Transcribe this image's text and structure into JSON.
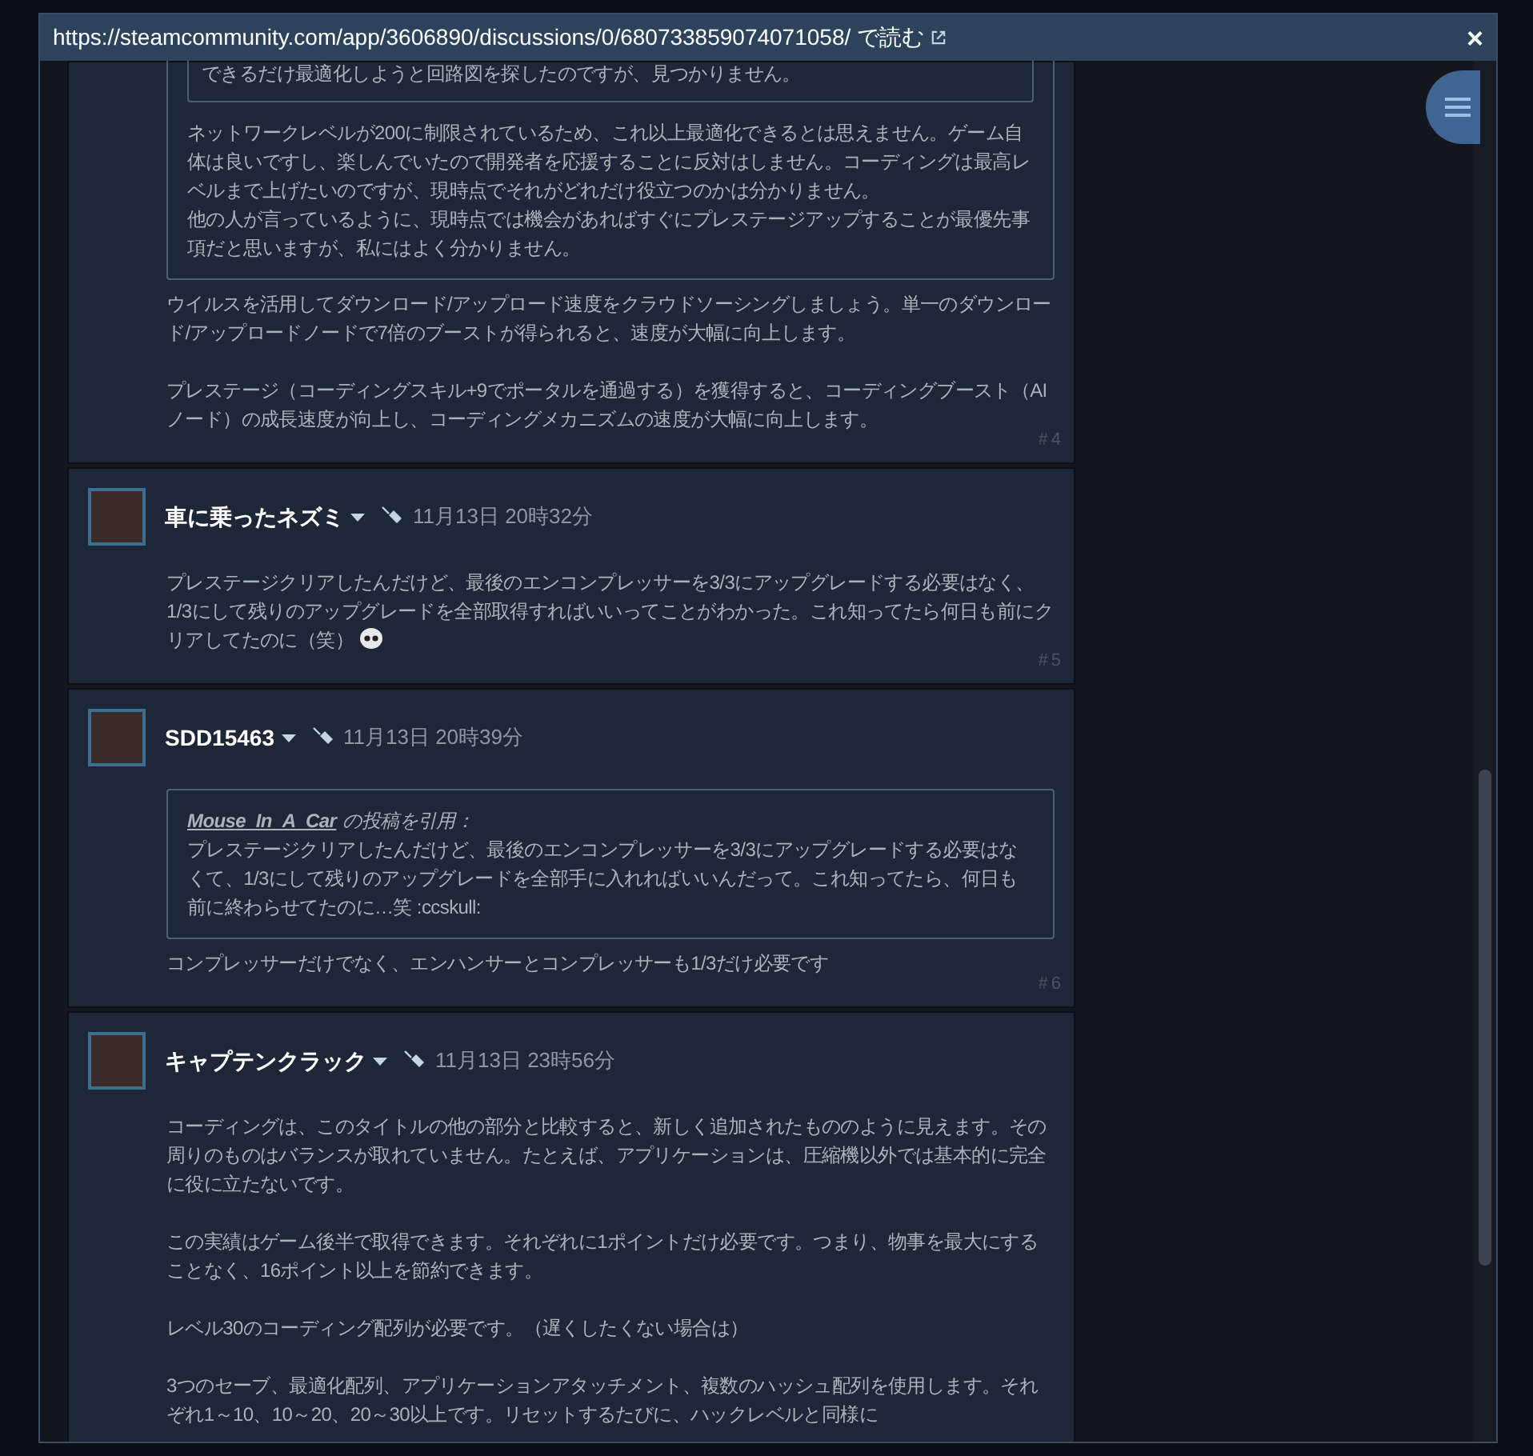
{
  "modal": {
    "url": "https://steamcommunity.com/app/3606890/discussions/0/680733859074071058/",
    "open_label": "で読む",
    "close": "×"
  },
  "posts": [
    {
      "quote": {
        "inner_text": "できるだけ最適化しようと回路図を探したのですが、見つかりません。",
        "paragraphs": [
          "ネットワークレベルが200に制限されているため、これ以上最適化できるとは思えません。ゲーム自体は良いですし、楽しんでいたので開発者を応援することに反対はしません。コーディングは最高レベルまで上げたいのですが、現時点でそれがどれだけ役立つのかは分かりません。",
          "他の人が言っているように、現時点では機会があればすぐにプレステージアップすることが最優先事項だと思いますが、私にはよく分かりません。"
        ]
      },
      "paragraphs": [
        "ウイルスを活用してダウンロード/アップロード速度をクラウドソーシングしましょう。単一のダウンロード/アップロードノードで7倍のブーストが得られると、速度が大幅に向上します。",
        "プレステージ（コーディングスキル+9でポータルを通過する）を獲得すると、コーディングブースト（AIノード）の成長速度が向上し、コーディングメカニズムの速度が大幅に向上します。"
      ],
      "number": "#4"
    },
    {
      "author": "車に乗ったネズミ",
      "date": "11月13日 20時32分",
      "paragraphs": [
        "プレステージクリアしたんだけど、最後のエンコンプレッサーを3/3にアップグレードする必要はなく、1/3にして残りのアップグレードを全部取得すればいいってことがわかった。これ知ってたら何日も前にクリアしてたのに（笑）"
      ],
      "trailing_emoji": true,
      "number": "#5"
    },
    {
      "author": "SDD15463",
      "date": "11月13日 20時39分",
      "quote": {
        "author": "Mouse_In_A_Car",
        "label": "の投稿を引用：",
        "paragraphs": [
          "プレステージクリアしたんだけど、最後のエンコンプレッサーを3/3にアップグレードする必要はなくて、1/3にして残りのアップグレードを全部手に入れればいいんだって。これ知ってたら、何日も前に終わらせてたのに…笑 :ccskull:"
        ]
      },
      "paragraphs": [
        "コンプレッサーだけでなく、エンハンサーとコンプレッサーも1/3だけ必要です"
      ],
      "number": "#6"
    },
    {
      "author": "キャプテンクラック",
      "date": "11月13日 23時56分",
      "paragraphs": [
        "コーディングは、このタイトルの他の部分と比較すると、新しく追加されたもののように見えます。その周りのものはバランスが取れていません。たとえば、アプリケーションは、圧縮機以外では基本的に完全に役に立たないです。",
        "この実績はゲーム後半で取得できます。それぞれに1ポイントだけ必要です。つまり、物事を最大にすることなく、16ポイント以上を節約できます。",
        "レベル30のコーディング配列が必要です。（遅くしたくない場合は）",
        "3つのセーブ、最適化配列、アプリケーションアタッチメント、複数のハッシュ配列を使用します。それぞれ1～10、10～20、20～30以上です。リセットするたびに、ハックレベルと同様に"
      ]
    }
  ]
}
